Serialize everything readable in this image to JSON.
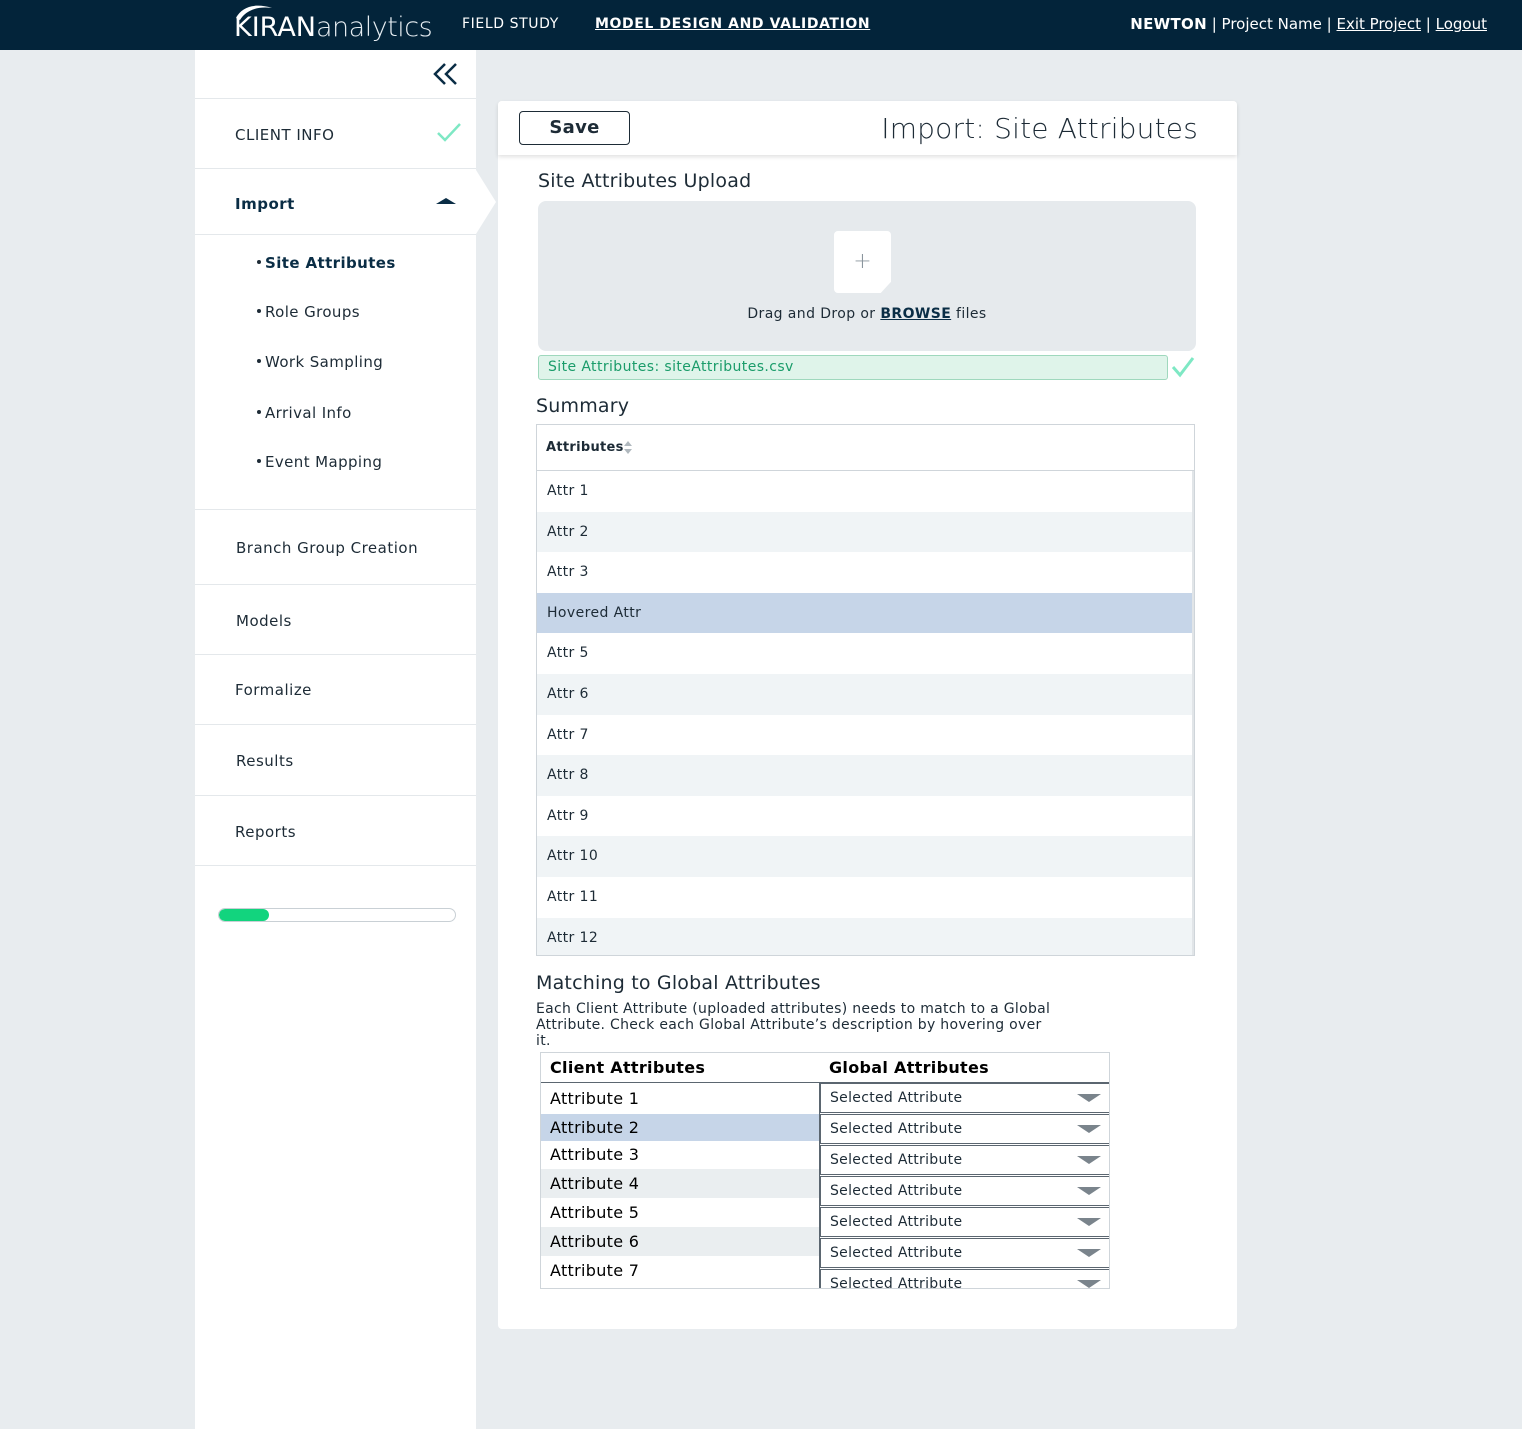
{
  "header": {
    "logo": {
      "brand_bold": "KIRAN",
      "brand_light": "analytics"
    },
    "nav": [
      {
        "label": "FIELD STUDY",
        "active": false
      },
      {
        "label": "MODEL DESIGN AND VALIDATION",
        "active": true
      }
    ],
    "user": "NEWTON",
    "separator": "|",
    "project_name": "Project Name",
    "exit_project": "Exit Project",
    "logout": "Logout"
  },
  "sidebar": {
    "client_info": "CLIENT INFO",
    "import": "Import",
    "import_subitems": [
      {
        "label": "Site Attributes",
        "active": true
      },
      {
        "label": "Role Groups",
        "active": false
      },
      {
        "label": "Work Sampling",
        "active": false
      },
      {
        "label": "Arrival Info",
        "active": false
      },
      {
        "label": "Event Mapping",
        "active": false
      }
    ],
    "branch_group_creation": "Branch Group Creation",
    "models": "Models",
    "formalize": "Formalize",
    "results": "Results",
    "reports": "Reports",
    "progress_percent": 21
  },
  "main": {
    "save_label": "Save",
    "title": "Import: Site Attributes",
    "upload": {
      "section_title": "Site Attributes Upload",
      "drop_prefix": "Drag and Drop or",
      "browse": "BROWSE",
      "drop_suffix": "files",
      "file_icon_glyph": "+",
      "uploaded_file": "Site Attributes: siteAttributes.csv"
    },
    "summary": {
      "section_title": "Summary",
      "column_header": "Attributes",
      "rows": [
        "Attr 1",
        "Attr 2",
        "Attr 3",
        "Hovered Attr",
        "Attr 5",
        "Attr 6",
        "Attr 7",
        "Attr 8",
        "Attr 9",
        "Attr 10",
        "Attr 11",
        "Attr 12"
      ],
      "hovered_row_index": 3
    },
    "matching": {
      "section_title": "Matching to Global Attributes",
      "description_line1": "Each Client Attribute (uploaded attributes) needs to match to a Global",
      "description_line2": "Attribute. Check each Global Attribute’s description by hovering over it.",
      "client_header": "Client Attributes",
      "global_header": "Global Attributes",
      "client_attributes": [
        "Attribute 1",
        "Attribute 2",
        "Attribute 3",
        "Attribute 4",
        "Attribute 5",
        "Attribute 6",
        "Attribute 7"
      ],
      "global_selected": [
        "Selected Attribute",
        "Selected Attribute",
        "Selected Attribute",
        "Selected Attribute",
        "Selected Attribute",
        "Selected Attribute",
        "Selected Attribute"
      ],
      "selected_client_index": 1
    }
  },
  "colors": {
    "topbar": "#03243a",
    "accent_green": "#12d47e",
    "check_mint": "#7ee8c4",
    "hover_row": "#c6d5e8",
    "file_pill_bg": "#dff4ea"
  },
  "icons": [
    "collapse-double-chevron-icon",
    "checkmark-icon",
    "caret-up-icon",
    "file-add-icon",
    "sort-icon",
    "dropdown-arrow-icon"
  ]
}
